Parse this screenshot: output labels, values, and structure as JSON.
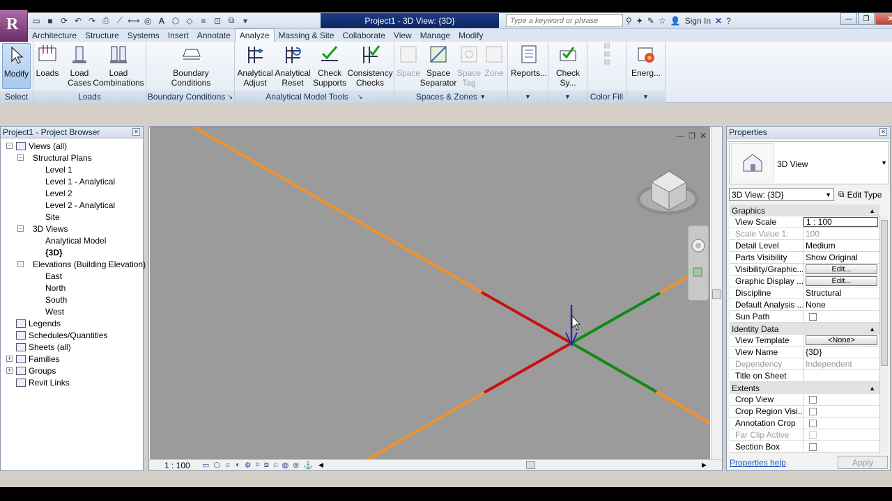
{
  "app": {
    "logo_letter": "R",
    "document_title": "Project1 - 3D View: {3D}",
    "search_placeholder": "Type a keyword or phrase",
    "sign_in": "Sign In"
  },
  "tabs": [
    "Architecture",
    "Structure",
    "Systems",
    "Insert",
    "Annotate",
    "Analyze",
    "Massing & Site",
    "Collaborate",
    "View",
    "Manage",
    "Modify"
  ],
  "active_tab": "Analyze",
  "ribbon": {
    "select": {
      "button": "Modify",
      "title": "Select"
    },
    "loads": {
      "buttons": [
        "Loads",
        "Load\nCases",
        "Load\nCombinations"
      ],
      "title": "Loads"
    },
    "boundary": {
      "button": "Boundary\nConditions",
      "title": "Boundary Conditions"
    },
    "analytical": {
      "buttons": [
        "Analytical\nAdjust",
        "Analytical\nReset",
        "Check\nSupports",
        "Consistency\nChecks"
      ],
      "title": "Analytical Model Tools"
    },
    "spaces": {
      "buttons": [
        "Space",
        "Space\nSeparator",
        "Space\nTag",
        "Zone"
      ],
      "title": "Spaces & Zones"
    },
    "reports": {
      "button": "Reports..."
    },
    "check": {
      "button": "Check Sy..."
    },
    "colorfill": {
      "title": "Color Fill"
    },
    "energy": {
      "button": "Energ..."
    }
  },
  "browser": {
    "title": "Project1 - Project Browser",
    "items": [
      {
        "label": "Views (all)",
        "level": 0,
        "exp": "-"
      },
      {
        "label": "Structural Plans",
        "level": 1,
        "exp": "-"
      },
      {
        "label": "Level 1",
        "level": 2
      },
      {
        "label": "Level 1 - Analytical",
        "level": 2
      },
      {
        "label": "Level 2",
        "level": 2
      },
      {
        "label": "Level 2 - Analytical",
        "level": 2
      },
      {
        "label": "Site",
        "level": 2
      },
      {
        "label": "3D Views",
        "level": 1,
        "exp": "-"
      },
      {
        "label": "Analytical Model",
        "level": 2
      },
      {
        "label": "{3D}",
        "level": 2,
        "bold": true
      },
      {
        "label": "Elevations (Building Elevation)",
        "level": 1,
        "exp": "-"
      },
      {
        "label": "East",
        "level": 2
      },
      {
        "label": "North",
        "level": 2
      },
      {
        "label": "South",
        "level": 2
      },
      {
        "label": "West",
        "level": 2
      },
      {
        "label": "Legends",
        "level": 0
      },
      {
        "label": "Schedules/Quantities",
        "level": 0
      },
      {
        "label": "Sheets (all)",
        "level": 0
      },
      {
        "label": "Families",
        "level": 0,
        "exp": "+"
      },
      {
        "label": "Groups",
        "level": 0,
        "exp": "+"
      },
      {
        "label": "Revit Links",
        "level": 0
      }
    ]
  },
  "view": {
    "scale": "1 : 100",
    "colors": {
      "background": "#9b9b9b",
      "orange": "#f0922b",
      "red": "#c81010",
      "green": "#0f8a16",
      "blue": "#2a2ab0"
    }
  },
  "properties": {
    "title": "Properties",
    "type_name": "3D View",
    "selector": "3D View: {3D}",
    "edit_type": "Edit Type",
    "sections": {
      "graphics": "Graphics",
      "identity": "Identity Data",
      "extents": "Extents"
    },
    "graphics_rows": [
      {
        "k": "View Scale",
        "v": "1 : 100",
        "kind": "input"
      },
      {
        "k": "Scale Value    1:",
        "v": "100",
        "kind": "text",
        "disabled": true
      },
      {
        "k": "Detail Level",
        "v": "Medium",
        "kind": "text"
      },
      {
        "k": "Parts Visibility",
        "v": "Show Original",
        "kind": "text"
      },
      {
        "k": "Visibility/Graphic...",
        "v": "Edit...",
        "kind": "button"
      },
      {
        "k": "Graphic Display ...",
        "v": "Edit...",
        "kind": "button"
      },
      {
        "k": "Discipline",
        "v": "Structural",
        "kind": "text"
      },
      {
        "k": "Default Analysis ...",
        "v": "None",
        "kind": "text"
      },
      {
        "k": "Sun Path",
        "v": "",
        "kind": "check"
      }
    ],
    "identity_rows": [
      {
        "k": "View Template",
        "v": "<None>",
        "kind": "button"
      },
      {
        "k": "View Name",
        "v": "{3D}",
        "kind": "text"
      },
      {
        "k": "Dependency",
        "v": "Independent",
        "kind": "text",
        "disabled": true
      },
      {
        "k": "Title on Sheet",
        "v": "",
        "kind": "text"
      }
    ],
    "extents_rows": [
      {
        "k": "Crop View",
        "v": "",
        "kind": "check"
      },
      {
        "k": "Crop Region Visi...",
        "v": "",
        "kind": "check"
      },
      {
        "k": "Annotation Crop",
        "v": "",
        "kind": "check"
      },
      {
        "k": "Far Clip Active",
        "v": "",
        "kind": "check",
        "disabled": true
      },
      {
        "k": "Section Box",
        "v": "",
        "kind": "check"
      }
    ],
    "help": "Properties help",
    "apply": "Apply"
  }
}
